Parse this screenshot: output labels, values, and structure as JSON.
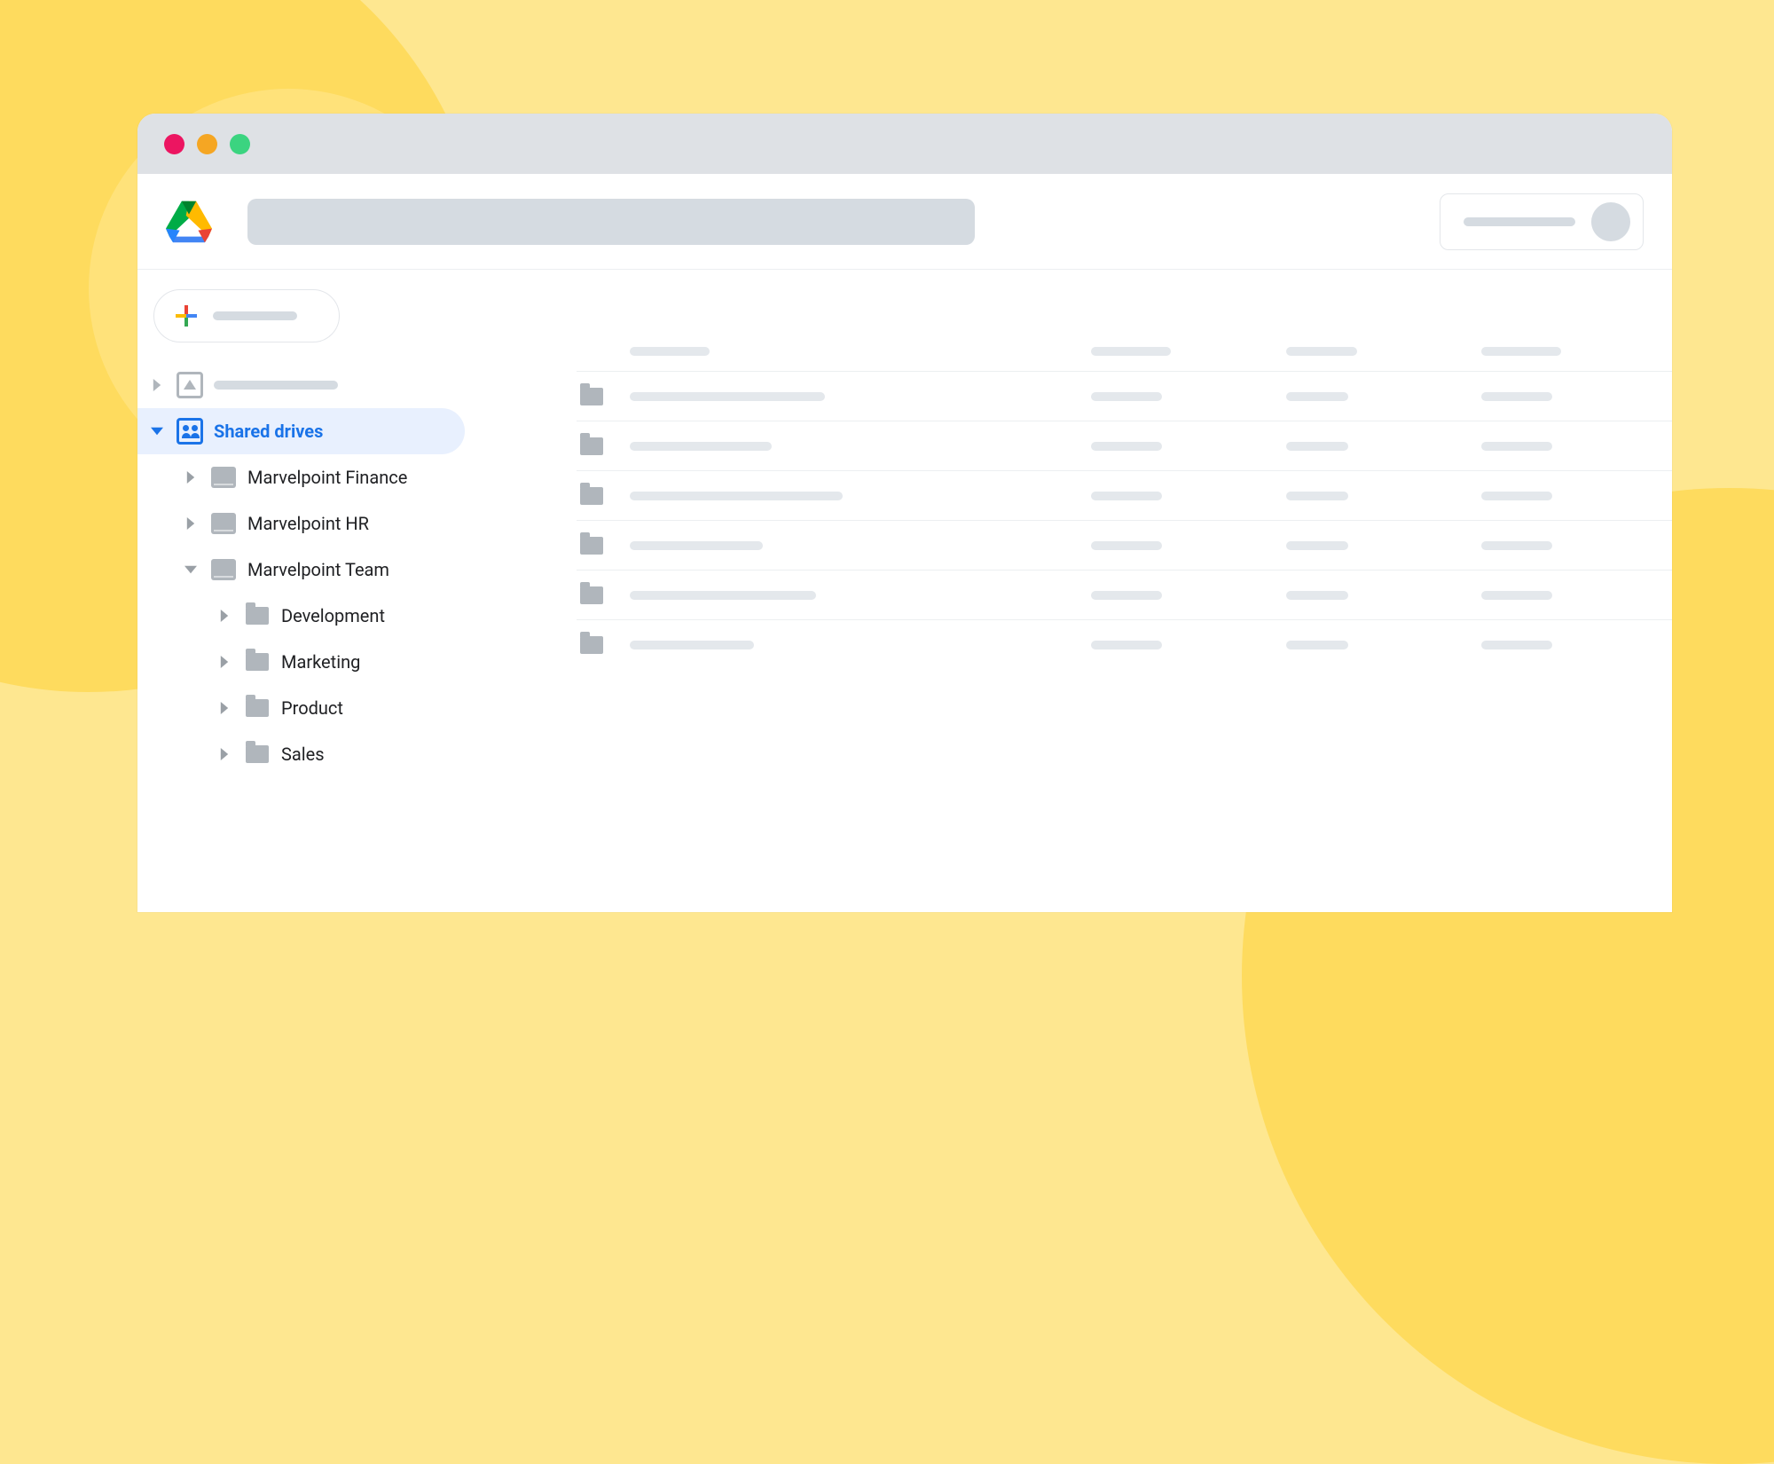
{
  "sidebar": {
    "shared_drives_label": "Shared drives",
    "drives": [
      {
        "label": "Marvelpoint Finance"
      },
      {
        "label": "Marvelpoint HR"
      },
      {
        "label": "Marvelpoint Team"
      }
    ],
    "team_folders": [
      {
        "label": "Development"
      },
      {
        "label": "Marketing"
      },
      {
        "label": "Product"
      },
      {
        "label": "Sales"
      }
    ]
  },
  "content": {
    "rows": [
      {
        "w1": 220,
        "w2": 80,
        "w3": 70,
        "w4": 80
      },
      {
        "w1": 160,
        "w2": 80,
        "w3": 70,
        "w4": 80
      },
      {
        "w1": 240,
        "w2": 80,
        "w3": 70,
        "w4": 80
      },
      {
        "w1": 150,
        "w2": 80,
        "w3": 70,
        "w4": 80
      },
      {
        "w1": 210,
        "w2": 80,
        "w3": 70,
        "w4": 80
      },
      {
        "w1": 140,
        "w2": 80,
        "w3": 70,
        "w4": 80
      }
    ]
  }
}
